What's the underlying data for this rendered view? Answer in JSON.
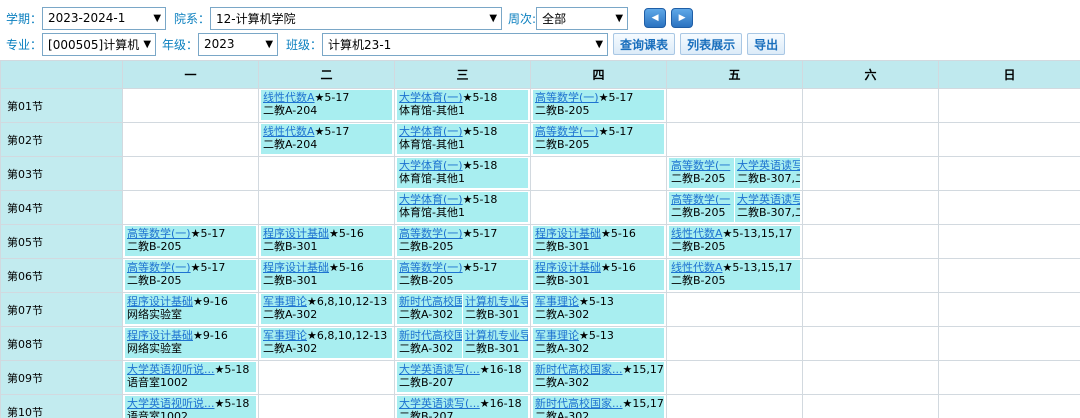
{
  "filters": {
    "term_label": "学期：",
    "term_value": "2023-2024-1",
    "college_label": "院系：",
    "college_value": "12-计算机学院",
    "week_label": "周次:",
    "week_value": "全部",
    "major_label": "专业：",
    "major_value": "[000505]计算机科",
    "grade_label": "年级：",
    "grade_value": "2023",
    "class_label": "班级：",
    "class_value": "计算机23-1",
    "query_button": "查询课表",
    "list_button": "列表展示",
    "export_button": "导出",
    "prev_icon": "left-triangle",
    "next_icon": "right-triangle"
  },
  "colors": {
    "header_bg": "#bfe9ee",
    "course_bg": "#a8eef0",
    "course_link": "#1e73d0",
    "label": "#0a7fbf"
  },
  "days": [
    "一",
    "二",
    "三",
    "四",
    "五",
    "六",
    "日"
  ],
  "periods": [
    {
      "label": "第01节",
      "cells": [
        [],
        [
          {
            "name": "线性代数A",
            "weeks": "★5-17",
            "room": "二教A-204"
          }
        ],
        [
          {
            "name": "大学体育(一)",
            "weeks": "★5-18",
            "room": "体育馆-其他1"
          }
        ],
        [
          {
            "name": "高等数学(一)",
            "weeks": "★5-17",
            "room": "二教B-205"
          }
        ],
        [],
        [],
        []
      ]
    },
    {
      "label": "第02节",
      "cells": [
        [],
        [
          {
            "name": "线性代数A",
            "weeks": "★5-17",
            "room": "二教A-204"
          }
        ],
        [
          {
            "name": "大学体育(一)",
            "weeks": "★5-18",
            "room": "体育馆-其他1"
          }
        ],
        [
          {
            "name": "高等数学(一)",
            "weeks": "★5-17",
            "room": "二教B-205"
          }
        ],
        [],
        [],
        []
      ]
    },
    {
      "label": "第03节",
      "cells": [
        [],
        [],
        [
          {
            "name": "大学体育(一)",
            "weeks": "★5-18",
            "room": "体育馆-其他1"
          }
        ],
        [],
        [
          {
            "name": "高等数学(一",
            "weeks": "",
            "room": "二教B-205"
          },
          {
            "name": "大学英语读写",
            "weeks": "",
            "room": "二教B-307,二"
          }
        ],
        [],
        []
      ]
    },
    {
      "label": "第04节",
      "cells": [
        [],
        [],
        [
          {
            "name": "大学体育(一)",
            "weeks": "★5-18",
            "room": "体育馆-其他1"
          }
        ],
        [],
        [
          {
            "name": "高等数学(一",
            "weeks": "",
            "room": "二教B-205"
          },
          {
            "name": "大学英语读写",
            "weeks": "",
            "room": "二教B-307,二"
          }
        ],
        [],
        []
      ]
    },
    {
      "label": "第05节",
      "cells": [
        [
          {
            "name": "高等数学(一)",
            "weeks": "★5-17",
            "room": "二教B-205"
          }
        ],
        [
          {
            "name": "程序设计基础",
            "weeks": "★5-16",
            "room": "二教B-301"
          }
        ],
        [
          {
            "name": "高等数学(一)",
            "weeks": "★5-17",
            "room": "二教B-205"
          }
        ],
        [
          {
            "name": "程序设计基础",
            "weeks": "★5-16",
            "room": "二教B-301"
          }
        ],
        [
          {
            "name": "线性代数A",
            "weeks": "★5-13,15,17",
            "room": "二教B-205"
          }
        ],
        [],
        []
      ]
    },
    {
      "label": "第06节",
      "cells": [
        [
          {
            "name": "高等数学(一)",
            "weeks": "★5-17",
            "room": "二教B-205"
          }
        ],
        [
          {
            "name": "程序设计基础",
            "weeks": "★5-16",
            "room": "二教B-301"
          }
        ],
        [
          {
            "name": "高等数学(一)",
            "weeks": "★5-17",
            "room": "二教B-205"
          }
        ],
        [
          {
            "name": "程序设计基础",
            "weeks": "★5-16",
            "room": "二教B-301"
          }
        ],
        [
          {
            "name": "线性代数A",
            "weeks": "★5-13,15,17",
            "room": "二教B-205"
          }
        ],
        [],
        []
      ]
    },
    {
      "label": "第07节",
      "cells": [
        [
          {
            "name": "程序设计基础",
            "weeks": "★9-16",
            "room": "网络实验室"
          }
        ],
        [
          {
            "name": "军事理论",
            "weeks": "★6,8,10,12-13",
            "room": "二教A-302"
          }
        ],
        [
          {
            "name": "新时代高校国",
            "weeks": "",
            "room": "二教A-302"
          },
          {
            "name": "计算机专业导",
            "weeks": "",
            "room": "二教B-301"
          }
        ],
        [
          {
            "name": "军事理论",
            "weeks": "★5-13",
            "room": "二教A-302"
          }
        ],
        [],
        [],
        []
      ]
    },
    {
      "label": "第08节",
      "cells": [
        [
          {
            "name": "程序设计基础",
            "weeks": "★9-16",
            "room": "网络实验室"
          }
        ],
        [
          {
            "name": "军事理论",
            "weeks": "★6,8,10,12-13",
            "room": "二教A-302"
          }
        ],
        [
          {
            "name": "新时代高校国",
            "weeks": "",
            "room": "二教A-302"
          },
          {
            "name": "计算机专业导",
            "weeks": "",
            "room": "二教B-301"
          }
        ],
        [
          {
            "name": "军事理论",
            "weeks": "★5-13",
            "room": "二教A-302"
          }
        ],
        [],
        [],
        []
      ]
    },
    {
      "label": "第09节",
      "cells": [
        [
          {
            "name": "大学英语视听说...",
            "weeks": "★5-18",
            "room": "语音室1002"
          }
        ],
        [],
        [
          {
            "name": "大学英语读写(...",
            "weeks": "★16-18",
            "room": "二教B-207"
          }
        ],
        [
          {
            "name": "新时代高校国家...",
            "weeks": "★15,17",
            "room": "二教A-302"
          }
        ],
        [],
        [],
        []
      ]
    },
    {
      "label": "第10节",
      "cells": [
        [
          {
            "name": "大学英语视听说...",
            "weeks": "★5-18",
            "room": "语音室1002"
          }
        ],
        [],
        [
          {
            "name": "大学英语读写(...",
            "weeks": "★16-18",
            "room": "二教B-207"
          }
        ],
        [
          {
            "name": "新时代高校国家...",
            "weeks": "★15,17",
            "room": "二教A-302"
          }
        ],
        [],
        [],
        []
      ]
    }
  ]
}
